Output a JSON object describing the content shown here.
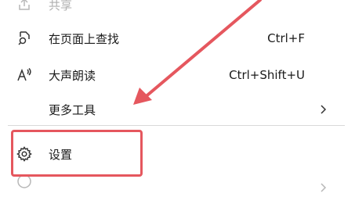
{
  "menu": {
    "items": [
      {
        "label": "共享",
        "icon": "share-icon"
      },
      {
        "label": "在页面上查找",
        "shortcut": "Ctrl+F",
        "icon": "find-in-page-icon"
      },
      {
        "label": "大声朗读",
        "shortcut": "Ctrl+Shift+U",
        "icon": "read-aloud-icon"
      },
      {
        "label": "更多工具",
        "icon": "chevron-right-icon"
      },
      {
        "label": "设置",
        "icon": "settings-gear-icon"
      }
    ]
  },
  "annotation": {
    "arrow_color": "#e5575e",
    "highlight_color": "#e5575e"
  }
}
